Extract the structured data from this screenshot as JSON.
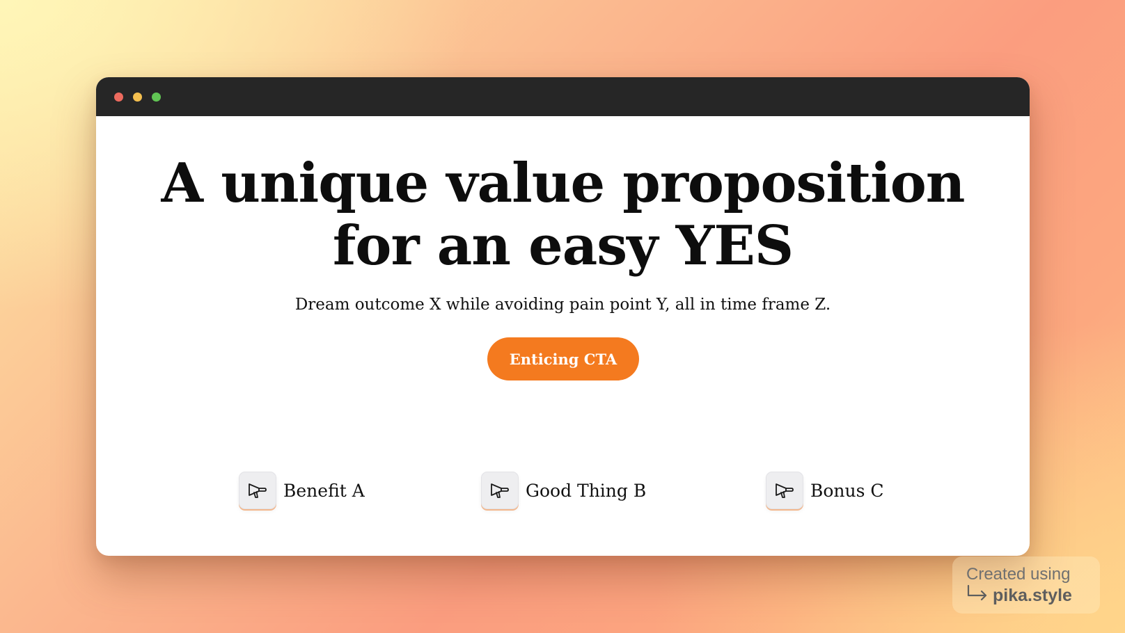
{
  "window": {
    "controls": [
      {
        "name": "close",
        "color": "#ec6a5e"
      },
      {
        "name": "minimize",
        "color": "#f4bf4f"
      },
      {
        "name": "zoom",
        "color": "#61c554"
      }
    ]
  },
  "hero": {
    "headline_line1": "A unique value proposition",
    "headline_line2": "for an easy YES",
    "subheadline": "Dream outcome X while avoiding pain point Y, all in time frame Z.",
    "cta_label": "Enticing CTA",
    "cta_color": "#f47a1f"
  },
  "benefits": [
    {
      "label": "Benefit A",
      "icon": "megaphone-icon"
    },
    {
      "label": "Good Thing B",
      "icon": "megaphone-icon"
    },
    {
      "label": "Bonus C",
      "icon": "megaphone-icon"
    }
  ],
  "watermark": {
    "line1": "Created using",
    "line2": "pika.style",
    "icon": "arrow-turn-right-icon"
  }
}
